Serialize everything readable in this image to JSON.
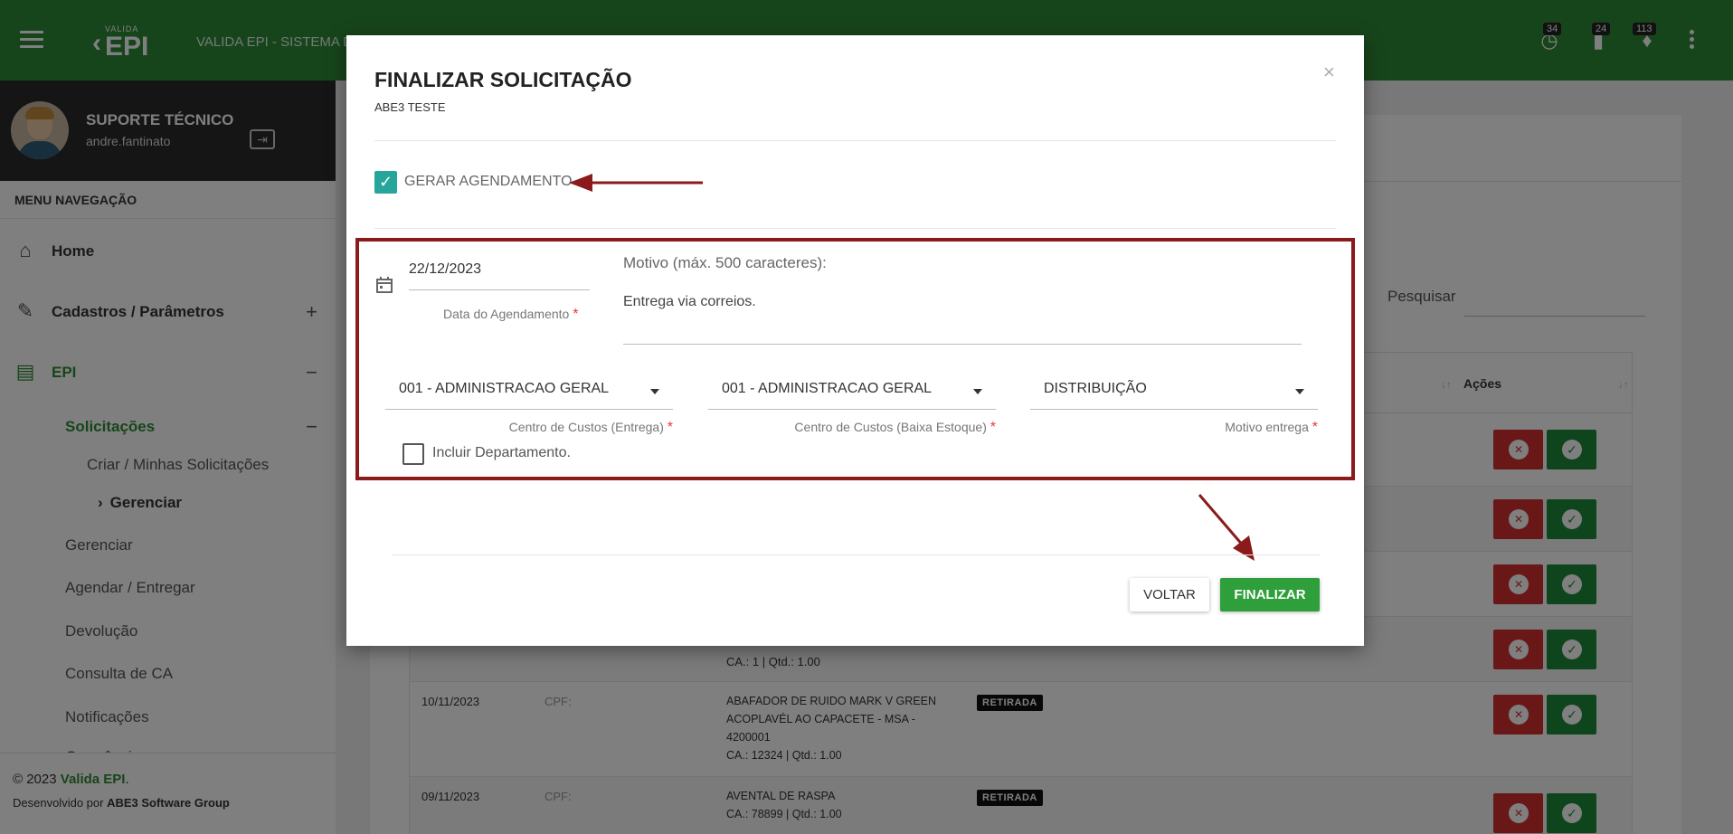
{
  "topbar": {
    "brand_small": "VALIDA",
    "brand_big": "EPI",
    "app_title": "VALIDA EPI - SISTEMA DE",
    "badges": {
      "history": "34",
      "tasks": "24",
      "notifications": "113"
    }
  },
  "sidebar": {
    "user_name": "SUPORTE TÉCNICO",
    "user_login": "andre.fantinato",
    "menu_header": "MENU NAVEGAÇÃO",
    "items": {
      "home": "Home",
      "cadastros": "Cadastros / Parâmetros",
      "cadastros_toggle": "+",
      "epi": "EPI",
      "epi_toggle": "−",
      "solicitacoes": "Solicitações",
      "solicitacoes_toggle": "−",
      "criar": "Criar / Minhas Solicitações",
      "gerenciar_sub": "Gerenciar",
      "gerenciar": "Gerenciar",
      "agendar": "Agendar / Entregar",
      "devolucao": "Devolução",
      "consulta_ca": "Consulta de CA",
      "notificacoes": "Notificações",
      "ocorrencias": "Ocorrências"
    },
    "footer": {
      "copyright": "© 2023 ",
      "brand": "Valida EPI",
      "period": ".",
      "dev_prefix": "Desenvolvido por ",
      "dev_company": "ABE3 Software Group"
    }
  },
  "background": {
    "search_label": "Pesquisar",
    "acoes_header": "Ações",
    "rows": [
      {
        "date": "",
        "cpf": "",
        "item": "CA.: 1 | Qtd.: 1.00",
        "status": ""
      },
      {
        "date": "10/11/2023",
        "cpf": "CPF:",
        "item_l1": "ABAFADOR DE RUIDO MARK V GREEN",
        "item_l2": "ACOPLAVÉL AO CAPACETE - MSA -",
        "item_l3": "4200001",
        "item_l4": "CA.: 12324 | Qtd.: 1.00",
        "status": "RETIRADA"
      },
      {
        "date": "09/11/2023",
        "cpf": "CPF:",
        "item_l1": "AVENTAL DE RASPA",
        "item_l2": "CA.: 78899 | Qtd.: 1.00",
        "status": "RETIRADA"
      }
    ]
  },
  "modal": {
    "title": "FINALIZAR SOLICITAÇÃO",
    "subtitle": "ABE3 TESTE",
    "close": "×",
    "gerar_agendamento": "GERAR AGENDAMENTO",
    "gerar_agendamento_checked": true,
    "date_value": "22/12/2023",
    "date_label": "Data do Agendamento",
    "motivo_label": "Motivo (máx. 500 caracteres):",
    "motivo_value": "Entrega via correios.",
    "cc_entrega_value": "001 - ADMINISTRACAO GERAL",
    "cc_entrega_label": "Centro de Custos (Entrega)",
    "cc_baixa_value": "001 - ADMINISTRACAO GERAL",
    "cc_baixa_label": "Centro de Custos (Baixa Estoque)",
    "motivo_entrega_value": "DISTRIBUIÇÃO",
    "motivo_entrega_label": "Motivo entrega",
    "incluir_departamento": "Incluir Departamento.",
    "incluir_departamento_checked": false,
    "required_mark": "*",
    "btn_voltar": "VOLTAR",
    "btn_finalizar": "FINALIZAR"
  },
  "colors": {
    "topbar": "#2e8b36",
    "accent_green": "#2e9f3a",
    "annotation_red": "#8b1a1a",
    "checkbox_teal": "#26a69a"
  }
}
